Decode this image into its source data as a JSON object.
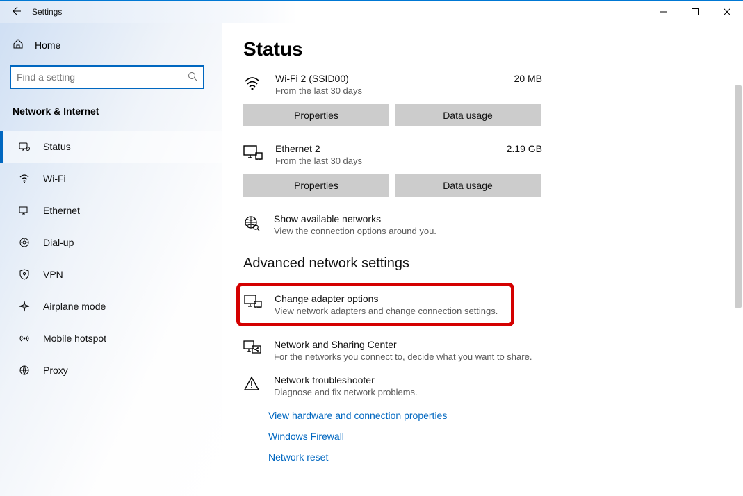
{
  "titlebar": {
    "title": "Settings"
  },
  "sidebar": {
    "home": "Home",
    "search_placeholder": "Find a setting",
    "category": "Network & Internet",
    "items": [
      {
        "label": "Status",
        "icon": "status-icon",
        "active": true
      },
      {
        "label": "Wi-Fi",
        "icon": "wifi-icon",
        "active": false
      },
      {
        "label": "Ethernet",
        "icon": "ethernet-icon",
        "active": false
      },
      {
        "label": "Dial-up",
        "icon": "dialup-icon",
        "active": false
      },
      {
        "label": "VPN",
        "icon": "vpn-icon",
        "active": false
      },
      {
        "label": "Airplane mode",
        "icon": "airplane-icon",
        "active": false
      },
      {
        "label": "Mobile hotspot",
        "icon": "hotspot-icon",
        "active": false
      },
      {
        "label": "Proxy",
        "icon": "proxy-icon",
        "active": false
      }
    ]
  },
  "main": {
    "title": "Status",
    "networks": [
      {
        "icon": "wifi-icon",
        "name": "Wi-Fi 2 (SSID00)",
        "sub": "From the last 30 days",
        "usage": "20 MB",
        "btn1": "Properties",
        "btn2": "Data usage"
      },
      {
        "icon": "ethernet-icon",
        "name": "Ethernet 2",
        "sub": "From the last 30 days",
        "usage": "2.19 GB",
        "btn1": "Properties",
        "btn2": "Data usage"
      }
    ],
    "show_networks": {
      "title": "Show available networks",
      "sub": "View the connection options around you."
    },
    "section_title": "Advanced network settings",
    "adv": [
      {
        "title": "Change adapter options",
        "sub": "View network adapters and change connection settings.",
        "icon": "adapter-icon",
        "highlight": true
      },
      {
        "title": "Network and Sharing Center",
        "sub": "For the networks you connect to, decide what you want to share.",
        "icon": "sharing-icon"
      },
      {
        "title": "Network troubleshooter",
        "sub": "Diagnose and fix network problems.",
        "icon": "troubleshoot-icon"
      }
    ],
    "links": [
      "View hardware and connection properties",
      "Windows Firewall",
      "Network reset"
    ]
  }
}
